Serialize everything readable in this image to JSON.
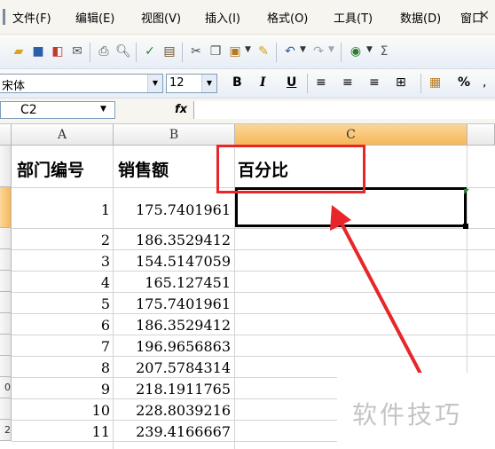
{
  "menu": {
    "items": [
      {
        "label": "文件(F)"
      },
      {
        "label": "编辑(E)"
      },
      {
        "label": "视图(V)"
      },
      {
        "label": "插入(I)"
      },
      {
        "label": "格式(O)"
      },
      {
        "label": "工具(T)"
      },
      {
        "label": "数据(D)"
      },
      {
        "label": "窗口"
      }
    ],
    "close_label": "×"
  },
  "format_bar": {
    "font_name": "宋体",
    "font_size": "12",
    "bold": "B",
    "italic": "I",
    "underline": "U",
    "percent": "%"
  },
  "formula_bar": {
    "name_box": "C2",
    "fx_label": "fx",
    "content": ""
  },
  "sheet": {
    "columns": [
      "A",
      "B",
      "C"
    ],
    "selected_column": "C",
    "header_row": {
      "A": "部门编号",
      "B": "销售额",
      "C": "百分比"
    },
    "rows": [
      {
        "a": "1",
        "b": "175.7401961"
      },
      {
        "a": "2",
        "b": "186.3529412"
      },
      {
        "a": "3",
        "b": "154.5147059"
      },
      {
        "a": "4",
        "b": "165.127451"
      },
      {
        "a": "5",
        "b": "175.7401961"
      },
      {
        "a": "6",
        "b": "186.3529412"
      },
      {
        "a": "7",
        "b": "196.9656863"
      },
      {
        "a": "8",
        "b": "207.5784314"
      },
      {
        "a": "9",
        "b": "218.1911765"
      },
      {
        "a": "10",
        "b": "228.8039216"
      },
      {
        "a": "11",
        "b": "239.4166667"
      }
    ],
    "row_numbers": [
      "0",
      "2"
    ],
    "active_cell": "C2"
  },
  "annotation": {
    "box_color": "#e8262a",
    "arrow_color": "#e8262a"
  },
  "watermark": "软件技巧"
}
